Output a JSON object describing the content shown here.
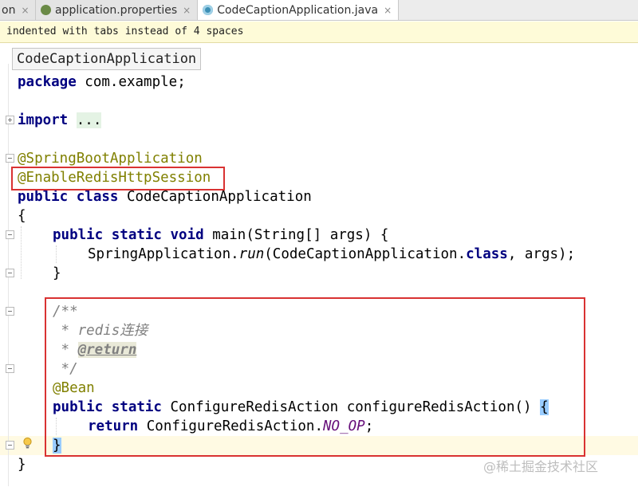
{
  "tabs": [
    {
      "label": "on",
      "icon": "none",
      "active": false
    },
    {
      "label": "application.properties",
      "icon": "properties-file-icon",
      "active": false
    },
    {
      "label": "CodeCaptionApplication.java",
      "icon": "java-class-icon",
      "active": true
    }
  ],
  "tab_close": "×",
  "banner_text": "indented with tabs instead of 4 spaces",
  "breadcrumb": "CodeCaptionApplication",
  "code": {
    "l_package_kw": "package",
    "l_package_rest": " com.example;",
    "l_import_kw": "import",
    "l_import_dots": "...",
    "l_ann1": "@SpringBootApplication",
    "l_ann2": "@EnableRedisHttpSession",
    "l_class_kw": "public class",
    "l_class_name": " CodeCaptionApplication",
    "l_open_brace": "{",
    "l_main_kw": "public static void",
    "l_main_rest": " main(String[] args) {",
    "l_run_pre": "SpringApplication.",
    "l_run_method": "run",
    "l_run_mid": "(CodeCaptionApplication.",
    "l_run_class_kw": "class",
    "l_run_post": ", args);",
    "l_close_main": "}",
    "l_doc_open": "/**",
    "l_doc_text": " * redis连接",
    "l_doc_star": " * ",
    "l_doc_tag": "@return",
    "l_doc_close": " */",
    "l_bean": "@Bean",
    "l_method_kw": "public static",
    "l_method_rest": " ConfigureRedisAction configureRedisAction() ",
    "l_method_brace": "{",
    "l_return_kw": "return",
    "l_return_pre": " ConfigureRedisAction.",
    "l_return_const": "NO_OP",
    "l_return_post": ";",
    "l_close_method": "}",
    "l_close_class": "}"
  },
  "watermark": "@稀土掘金技术社区",
  "colors": {
    "annotation_box": "#d93232",
    "keyword": "#000080",
    "annotation": "#808000",
    "comment": "#808080"
  }
}
